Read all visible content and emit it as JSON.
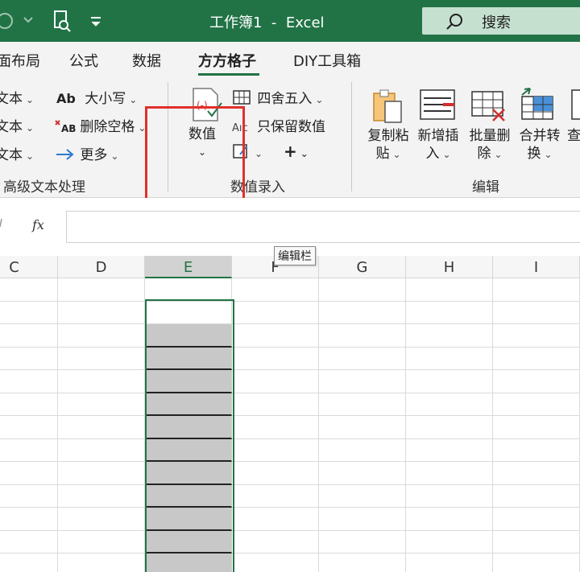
{
  "titlebar": {
    "title": "工作簿1  -  Excel",
    "search_label": "搜索"
  },
  "ribbon": {
    "tabs": [
      {
        "label": "面布局",
        "active": false
      },
      {
        "label": "公式",
        "active": false
      },
      {
        "label": "数据",
        "active": false
      },
      {
        "label": "方方格子",
        "active": true
      },
      {
        "label": "DIY工具箱",
        "active": false
      }
    ],
    "text_group": {
      "left_items": [
        "文本",
        "文本",
        "文本"
      ],
      "case_label": "大小写",
      "case_icon_text": "Ab",
      "delete_space_label": "删除空格",
      "more_label": "更多",
      "group_label": "高级文本处理"
    },
    "number_group": {
      "value_label": "数值",
      "round_label": "四舍五入",
      "keep_value_label": "只保留数值",
      "keep_value_icon_text": "Aıc",
      "plus_label": "+",
      "group_label": "数值录入"
    },
    "edit_group": {
      "buttons": [
        {
          "line1": "复制粘",
          "line2": "贴"
        },
        {
          "line1": "新增插",
          "line2": "入"
        },
        {
          "line1": "批量删",
          "line2": "除"
        },
        {
          "line1": "合并转",
          "line2": "换"
        },
        {
          "line1": "查",
          "line2": ""
        }
      ],
      "group_label": "编辑"
    }
  },
  "formula_bar": {
    "fx_label": "fx",
    "tooltip": "编辑栏"
  },
  "grid": {
    "columns": [
      "C",
      "D",
      "E",
      "F",
      "G",
      "H",
      "I"
    ],
    "selected_column": "E"
  },
  "colors": {
    "accent": "#217346",
    "highlight": "#e0302a"
  }
}
